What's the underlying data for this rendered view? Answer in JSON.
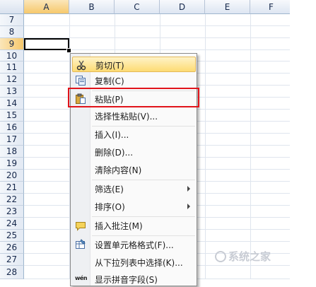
{
  "columns": [
    "A",
    "B",
    "C",
    "D",
    "E",
    "F"
  ],
  "rows": [
    "7",
    "8",
    "9",
    "10",
    "11",
    "12",
    "13",
    "14",
    "15",
    "16",
    "17",
    "18",
    "19",
    "20",
    "21",
    "22",
    "23",
    "24",
    "25",
    "26",
    "27",
    "28"
  ],
  "selected_column": "A",
  "selected_row": "9",
  "context_menu": {
    "items": [
      {
        "label": "剪切(T)",
        "icon": "scissors-icon",
        "highlighted": true
      },
      {
        "label": "复制(C)",
        "icon": "copy-icon"
      },
      {
        "label": "粘贴(P)",
        "icon": "paste-icon"
      },
      {
        "label": "选择性粘贴(V)..."
      },
      {
        "label": "插入(I)..."
      },
      {
        "label": "删除(D)..."
      },
      {
        "label": "清除内容(N)"
      },
      {
        "label": "筛选(E)",
        "submenu": true
      },
      {
        "label": "排序(O)",
        "submenu": true
      },
      {
        "label": "插入批注(M)",
        "icon": "comment-icon"
      },
      {
        "label": "设置单元格格式(F)...",
        "icon": "format-cells-icon"
      },
      {
        "label": "从下拉列表中选择(K)..."
      },
      {
        "label": "显示拼音字段(S)",
        "icon": "phonetic-icon"
      }
    ]
  },
  "phonetic_icon_text": "wén",
  "colors": {
    "highlight": "#fddb73",
    "annotation_box": "#e1141b"
  }
}
